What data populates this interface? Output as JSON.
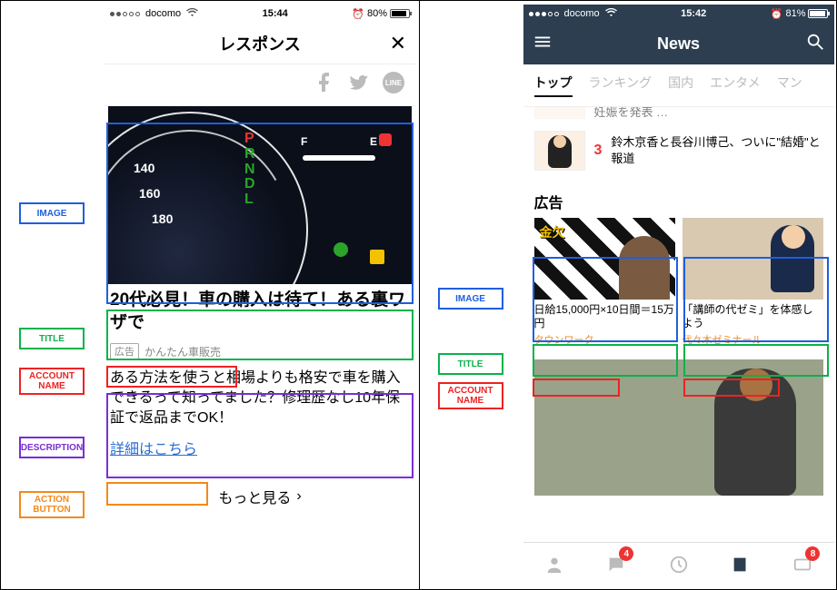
{
  "annotations": {
    "image": "IMAGE",
    "title": "TITLE",
    "account_name": "ACCOUNT\nNAME",
    "description": "DESCRIPTION",
    "action_button": "ACTION\nBUTTON"
  },
  "left": {
    "status": {
      "carrier": "docomo",
      "time": "15:44",
      "battery_pct": "80%",
      "battery_fill": 80
    },
    "header_title": "レスポンス",
    "ad": {
      "badge": "広告",
      "account": "かんたん車販売",
      "title": "20代必見！車の購入は待て！ある裏ワザで",
      "description": "ある方法を使うと相場よりも格安で車を購入できるって知ってました？修理歴なし10年保証で返品までOK！",
      "action": "詳細はこちら",
      "gauge": {
        "t1": "140",
        "t2": "160",
        "t3": "180",
        "F": "F",
        "E": "E",
        "P": "P",
        "R": "R",
        "N": "N",
        "D": "D",
        "L": "L"
      }
    },
    "more": "もっと見る"
  },
  "right": {
    "status": {
      "carrier": "docomo",
      "time": "15:42",
      "battery_pct": "81%",
      "battery_fill": 81
    },
    "header_title": "News",
    "tabs": [
      "トップ",
      "ランキング",
      "国内",
      "エンタメ",
      "マン"
    ],
    "news_partial": "妊娠を発表 …",
    "news": {
      "rank": "3",
      "text": "鈴木京香と長谷川博己、ついに\"結婚\"と報道"
    },
    "ads_heading": "広告",
    "ads": [
      {
        "kane": "金欠",
        "title": "日給15,000円×10日間＝15万円",
        "account": "タウンワーク"
      },
      {
        "title": "「講師の代ゼミ」を体感しよう",
        "account": "代々木ゼミナール"
      }
    ],
    "badges": {
      "chat": "4",
      "wallet": "8"
    }
  }
}
